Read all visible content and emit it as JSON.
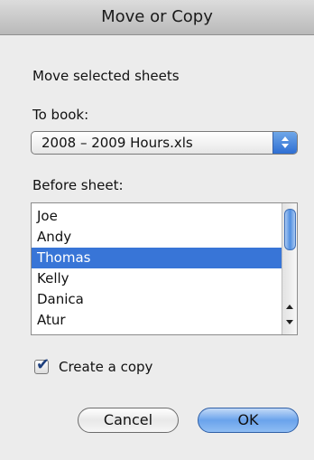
{
  "dialog": {
    "title": "Move or Copy",
    "heading": "Move selected sheets",
    "to_book_label": "To book:",
    "to_book_value": "2008 – 2009 Hours.xls",
    "before_sheet_label": "Before sheet:",
    "sheets": [
      {
        "name": "Joe",
        "selected": false
      },
      {
        "name": "Andy",
        "selected": false
      },
      {
        "name": "Thomas",
        "selected": true
      },
      {
        "name": "Kelly",
        "selected": false
      },
      {
        "name": "Danica",
        "selected": false
      },
      {
        "name": "Atur",
        "selected": false
      }
    ],
    "create_copy_label": "Create a copy",
    "create_copy_checked": true,
    "cancel_label": "Cancel",
    "ok_label": "OK"
  },
  "colors": {
    "selection": "#3875d7",
    "default_button": "#6aa3ec"
  }
}
